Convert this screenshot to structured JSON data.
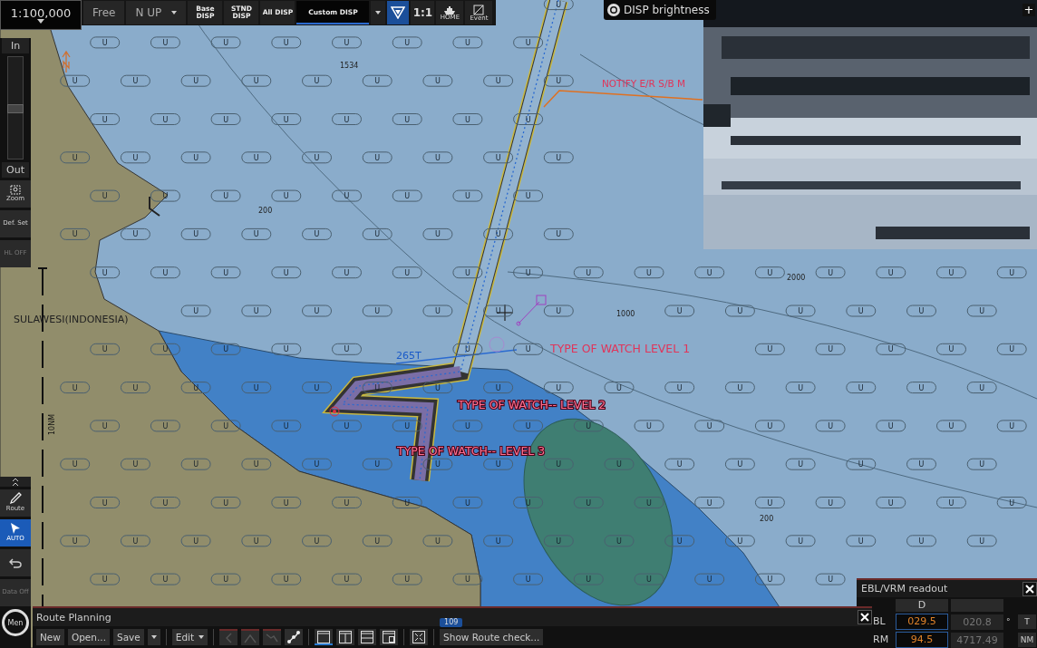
{
  "toolbar": {
    "scale": "1:100,000",
    "mode": "Free",
    "orientation": "N UP",
    "display_buttons": [
      {
        "label": "Base DISP",
        "selected": false
      },
      {
        "label": "STND DISP",
        "selected": false
      },
      {
        "label": "All DISP",
        "selected": false
      },
      {
        "label": "Custom DISP",
        "selected": true
      }
    ],
    "tools": [
      {
        "kind": "filter",
        "selected": true
      },
      {
        "kind": "text",
        "label": "1:1"
      },
      {
        "kind": "home",
        "label": "HOME"
      },
      {
        "kind": "event",
        "label": "Event"
      }
    ],
    "brightness": "DISP brightness"
  },
  "camera_view": {
    "kind": "picture",
    "button": "+"
  },
  "sidebar": {
    "zoom_in": "In",
    "zoom_out": "Out",
    "level": 0.5,
    "buttons": [
      {
        "kind": "zoom",
        "label": "Zoom",
        "disabled": false
      },
      {
        "kind": "text",
        "label": "Def. Set",
        "disabled": false
      },
      {
        "kind": "text",
        "label": "HL OFF",
        "disabled": true
      }
    ],
    "tools": [
      {
        "kind": "collapse"
      },
      {
        "kind": "route",
        "label": "Route",
        "selected": false
      },
      {
        "kind": "auto",
        "label": "AUTO",
        "selected": true
      },
      {
        "kind": "undo"
      },
      {
        "kind": "text",
        "label": "Data Off"
      }
    ],
    "menu": "Men"
  },
  "chart": {
    "area_symbols": [
      "U",
      "U",
      "U",
      "U",
      "U",
      "U",
      "U",
      "U",
      "U",
      "U",
      "U",
      "U",
      "U",
      "U",
      "U",
      "U",
      "U",
      "U",
      "U",
      "U",
      "U",
      "U",
      "U",
      "U",
      "U",
      "U",
      "U",
      "U",
      "U",
      "U",
      "U",
      "U",
      "U",
      "U",
      "U",
      "U",
      "U",
      "U",
      "U",
      "U",
      "U",
      "U",
      "U",
      "U",
      "U",
      "U",
      "U",
      "U",
      "U",
      "U",
      "U",
      "U",
      "U",
      "U",
      "U",
      "U",
      "U",
      "U",
      "U",
      "U",
      "U",
      "U",
      "U",
      "U",
      "U",
      "U",
      "U",
      "U",
      "U",
      "U",
      "U",
      "U",
      "U",
      "U",
      "U",
      "U",
      "U",
      "U",
      "U",
      "U",
      "U",
      "U",
      "U",
      "U",
      "U",
      "U",
      "U",
      "U",
      "U",
      "U",
      "U",
      "U",
      "U",
      "U",
      "U",
      "U",
      "U",
      "U",
      "U",
      "U",
      "U",
      "U",
      "U",
      "U",
      "U",
      "U",
      "U",
      "U",
      "U",
      "U",
      "U",
      "U",
      "U",
      "U",
      "U",
      "U",
      "U",
      "U",
      "U",
      "U",
      "U",
      "U",
      "U",
      "U",
      "U",
      "U",
      "U",
      "U",
      "U",
      "U",
      "U",
      "U",
      "U",
      "U",
      "U",
      "U",
      "U",
      "U",
      "U",
      "U",
      "U",
      "U",
      "U",
      "U",
      "U",
      "U",
      "U",
      "U",
      "U",
      "U",
      "U",
      "U",
      "U",
      "U",
      "U",
      "U",
      "U",
      "U",
      "U",
      "U",
      "U",
      "U",
      "U",
      "U",
      "U",
      "U",
      "U",
      "U",
      "U",
      "U",
      "U",
      "U",
      "U",
      "U",
      "U",
      "U",
      "U",
      "U",
      "U",
      "U",
      "U",
      "U",
      "U",
      "U",
      "U",
      "U"
    ],
    "labels": [
      {
        "kind": "depth",
        "text": "1534"
      },
      {
        "kind": "notice",
        "text": "NOTIFY E/R S/B M"
      },
      {
        "kind": "depth",
        "text": "200"
      },
      {
        "kind": "depth",
        "text": "2000"
      },
      {
        "kind": "depth",
        "text": "1000"
      },
      {
        "kind": "place",
        "text": "SULAWESI(INDONESIA)"
      },
      {
        "kind": "notice",
        "text": "TYPE OF WATCH LEVEL 1"
      },
      {
        "kind": "bearing",
        "text": "265T"
      },
      {
        "kind": "notice",
        "text": "TYPE OF WATCH-- LEVEL 2"
      },
      {
        "kind": "scale",
        "text": "10NM"
      },
      {
        "kind": "notice",
        "text": "TYPE OF WATCH-- LEVEL 3"
      },
      {
        "kind": "depth",
        "text": "200"
      }
    ]
  },
  "route_planning": {
    "title": "Route Planning",
    "buttons": [
      {
        "kind": "text",
        "label": "New"
      },
      {
        "kind": "text",
        "label": "Open..."
      },
      {
        "kind": "text",
        "label": "Save"
      },
      {
        "kind": "caret"
      },
      {
        "kind": "dropdown",
        "label": "Edit"
      }
    ],
    "icon_tools": [
      {
        "kind": "left",
        "disabled": true
      },
      {
        "kind": "bend-up",
        "disabled": true
      },
      {
        "kind": "bend-down",
        "disabled": true
      },
      {
        "kind": "nodes",
        "disabled": false
      }
    ],
    "layouts": [
      {
        "kind": "single",
        "selected": true
      },
      {
        "kind": "columns",
        "selected": false
      },
      {
        "kind": "rows",
        "selected": false
      },
      {
        "kind": "inset",
        "selected": false
      }
    ],
    "check": {
      "label": "Show Route check...",
      "badge": "109"
    }
  },
  "ebl_vrm": {
    "title": "EBL/VRM readout",
    "header": "D",
    "rows": [
      {
        "label": "BL",
        "value": "029.5",
        "second": "020.8",
        "mark": "°",
        "unit": "T"
      },
      {
        "label": "RM",
        "value": "94.5",
        "second": "4717.49",
        "unit": "NM"
      }
    ]
  }
}
